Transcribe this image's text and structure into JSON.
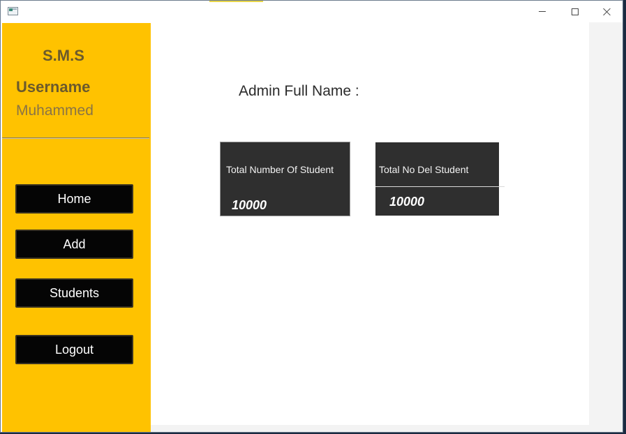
{
  "sidebar": {
    "brand": "S.M.S",
    "user_label": "Username",
    "user_name": "Muhammed",
    "nav": {
      "home": "Home",
      "add": "Add",
      "students": "Students",
      "logout": "Logout"
    }
  },
  "main": {
    "admin_label": "Admin Full Name :",
    "cards": [
      {
        "title": "Total Number Of Student",
        "value": "10000"
      },
      {
        "title": "Total No Del Student",
        "value": "10000"
      }
    ]
  },
  "colors": {
    "sidebar": "#ffc200",
    "card": "#2f2f2f",
    "nav_button": "#050505"
  },
  "icons": {
    "app": "app-window-icon",
    "minimize": "minimize-icon",
    "maximize": "maximize-icon",
    "close": "close-icon"
  }
}
